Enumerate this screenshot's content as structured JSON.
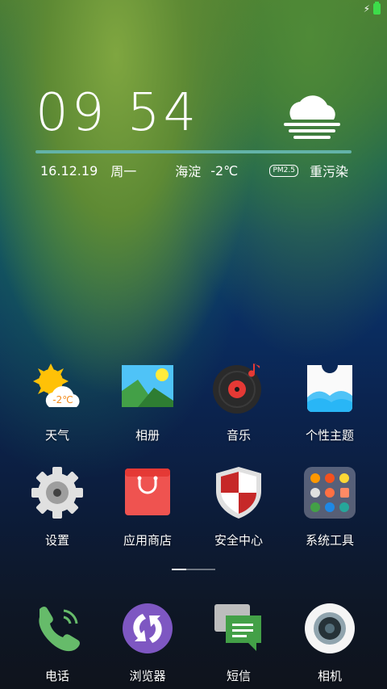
{
  "clock": {
    "time": "09 54"
  },
  "widget": {
    "date": "16.12.19",
    "weekday": "周一",
    "location": "海淀",
    "temperature": "-2℃",
    "pm_label": "PM2.5",
    "air_quality": "重污染"
  },
  "apps": {
    "row1": [
      {
        "label": "天气",
        "badge": "-2℃"
      },
      {
        "label": "相册"
      },
      {
        "label": "音乐"
      },
      {
        "label": "个性主题"
      }
    ],
    "row2": [
      {
        "label": "设置"
      },
      {
        "label": "应用商店"
      },
      {
        "label": "安全中心"
      },
      {
        "label": "系统工具"
      }
    ]
  },
  "dock": [
    {
      "label": "电话"
    },
    {
      "label": "浏览器"
    },
    {
      "label": "短信"
    },
    {
      "label": "相机"
    }
  ],
  "colors": {
    "accent_bar": "#63b3a8",
    "battery": "#3ddc4a"
  }
}
